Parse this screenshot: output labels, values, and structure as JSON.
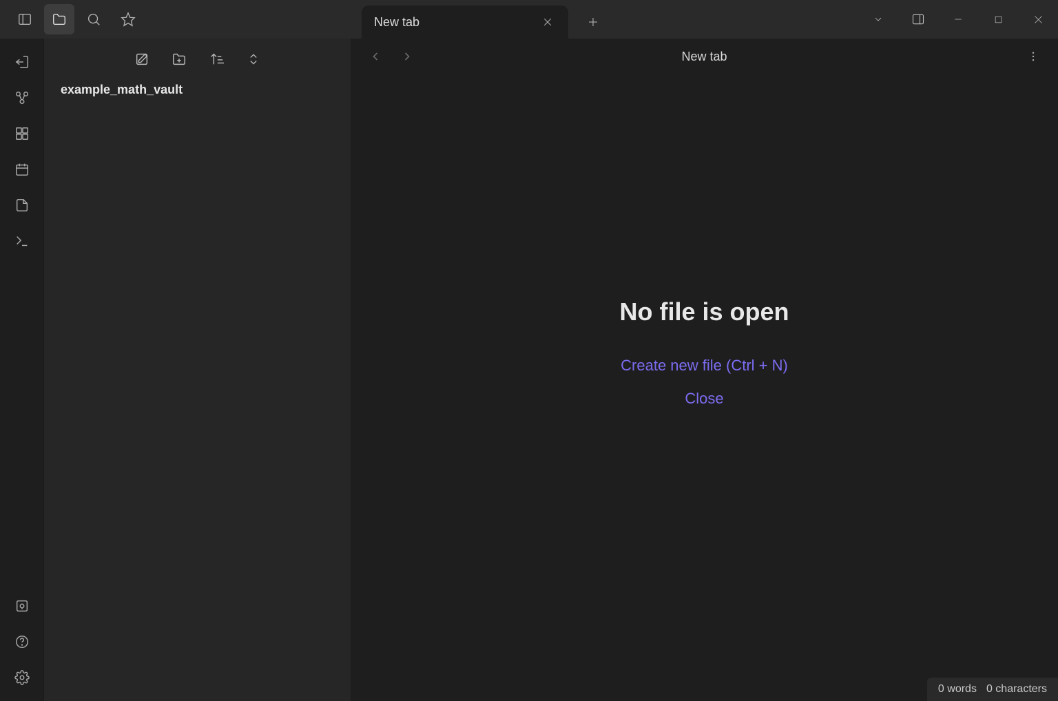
{
  "titlebar": {
    "icons": [
      "panel-left",
      "files",
      "search",
      "star"
    ],
    "active_icon_index": 1
  },
  "tab": {
    "label": "New tab"
  },
  "window_controls": [
    "dropdown",
    "panel-right",
    "minimize",
    "maximize",
    "close"
  ],
  "ribbon": {
    "top": [
      "quick-switcher",
      "graph",
      "canvas",
      "calendar",
      "note",
      "terminal"
    ],
    "bottom": [
      "vault",
      "help",
      "settings"
    ]
  },
  "sidebar": {
    "toolbar": [
      "new-note",
      "new-folder",
      "sort",
      "collapse-expand"
    ],
    "vault_name": "example_math_vault"
  },
  "main": {
    "title": "New tab",
    "empty_heading": "No file is open",
    "create_link": "Create new file (Ctrl + N)",
    "close_link": "Close"
  },
  "status": {
    "words": "0 words",
    "chars": "0 characters"
  }
}
